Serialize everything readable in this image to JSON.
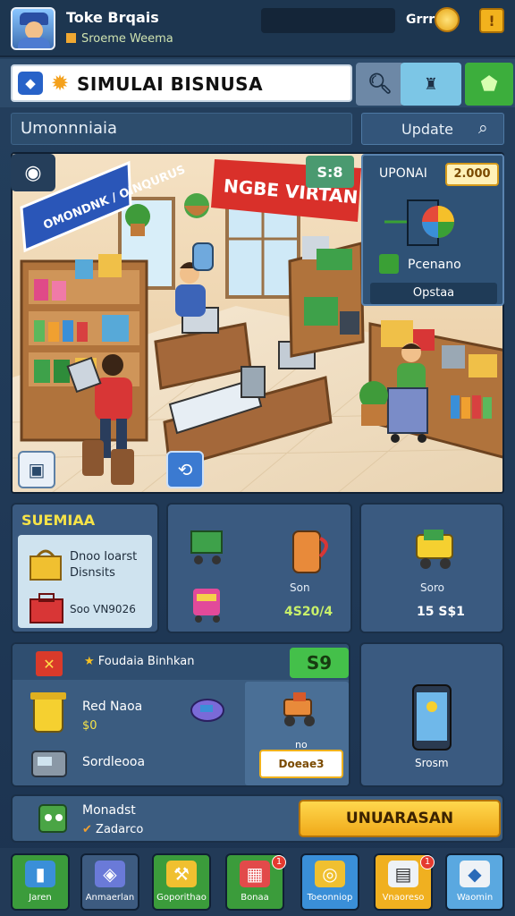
{
  "player": {
    "name": "Toke Brqais",
    "subtitle": "Sroeme Weema"
  },
  "currency": {
    "label": "Grrr"
  },
  "title": {
    "text": "SIMULAI BISNUSA"
  },
  "section": {
    "label": "Umonnniaia",
    "update_label": "Update"
  },
  "scene": {
    "shop_sign": "NGBE VIRTAN",
    "left_sign": "OMONDNK / OINQURUS",
    "score_badge": "S:8"
  },
  "upgrade_panel": {
    "title": "UPONAI",
    "price": "2.000",
    "item_label": "Pcenano",
    "option_label": "Opstaa"
  },
  "cards": {
    "c1": {
      "header": "SUEMIAA",
      "line1": "Dnoo Ioarst",
      "line2": "Disnsits",
      "value": "Soo VN9026"
    },
    "c2": {
      "label": "Son",
      "value": "4S20/4"
    },
    "c3": {
      "label": "Soro",
      "value": "15 S$1"
    },
    "c4": {
      "header": "Foudaia Binhkan",
      "badge": "S9",
      "row1": "Red Naoa",
      "row2": "$0",
      "row3": "Sordleooa",
      "note": "no",
      "button": "Doeae3"
    },
    "c5": {
      "label": "Srosm"
    },
    "c6": {
      "line1": "Monadst",
      "line2": "Zadarco",
      "button": "UNUARASAN"
    }
  },
  "nav": [
    {
      "label": "Jaren"
    },
    {
      "label": "Anmaerlan"
    },
    {
      "label": "Goporithao"
    },
    {
      "label": "Bonaa"
    },
    {
      "label": "Toeonniop"
    },
    {
      "label": "Vnaoreso"
    },
    {
      "label": "Waomin"
    }
  ],
  "nav_badges": [
    "1",
    "1"
  ]
}
